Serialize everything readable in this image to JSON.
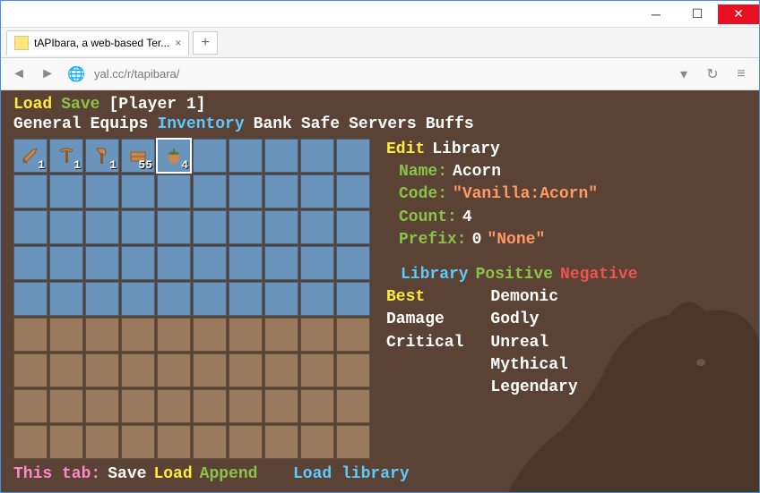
{
  "browser": {
    "tab_title": "tAPIbara, a web-based Ter...",
    "url": "yal.cc/r/tapibara/"
  },
  "top": {
    "load": "Load",
    "save": "Save",
    "player": "[Player 1]"
  },
  "tabs": {
    "general": "General",
    "equips": "Equips",
    "inventory": "Inventory",
    "bank": "Bank",
    "safe": "Safe",
    "servers": "Servers",
    "buffs": "Buffs"
  },
  "slots": [
    {
      "icon": "sword",
      "qty": "1"
    },
    {
      "icon": "pickaxe",
      "qty": "1"
    },
    {
      "icon": "axe",
      "qty": "1"
    },
    {
      "icon": "wood",
      "qty": "55"
    },
    {
      "icon": "acorn",
      "qty": "4",
      "selected": true
    }
  ],
  "edit": {
    "edit": "Edit",
    "library": "Library"
  },
  "item": {
    "name_k": "Name:",
    "name_v": "Acorn",
    "code_k": "Code:",
    "code_v": "\"Vanilla:Acorn\"",
    "count_k": "Count:",
    "count_v": "4",
    "prefix_k": "Prefix:",
    "prefix_n": "0",
    "prefix_v": "\"None\""
  },
  "pfx": {
    "library": "Library",
    "positive": "Positive",
    "negative": "Negative",
    "col1": [
      "Best",
      "Damage",
      "Critical"
    ],
    "col2": [
      "Demonic",
      "Godly",
      "Unreal",
      "Mythical",
      "Legendary"
    ]
  },
  "bottom": {
    "this_tab": "This tab:",
    "save": "Save",
    "load": "Load",
    "append": "Append",
    "loadlib": "Load library"
  }
}
